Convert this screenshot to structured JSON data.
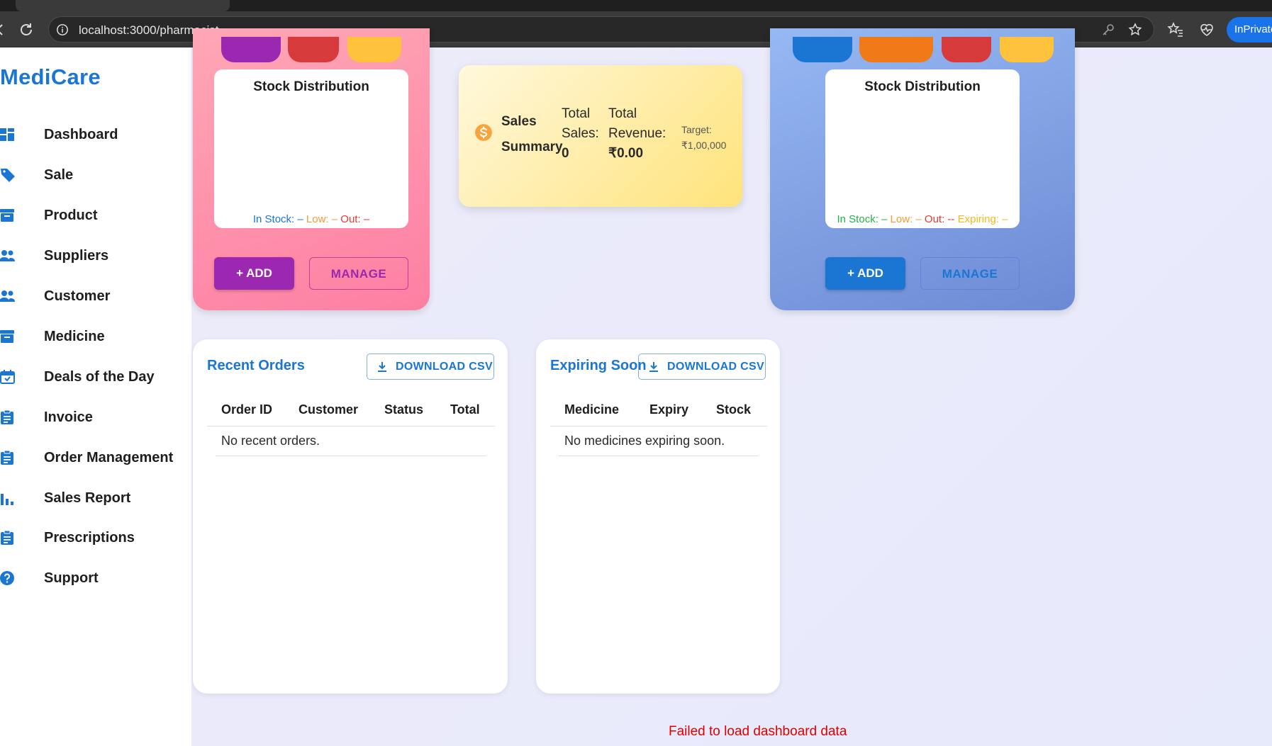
{
  "browser": {
    "url": "localhost:3000/pharmacist",
    "profile_label": "InPrivate"
  },
  "sidebar": {
    "brand": "MediCare",
    "items": [
      {
        "label": "Dashboard",
        "icon": "dashboard-icon"
      },
      {
        "label": "Sale",
        "icon": "tag-icon"
      },
      {
        "label": "Product",
        "icon": "archive-icon"
      },
      {
        "label": "Suppliers",
        "icon": "people-icon"
      },
      {
        "label": "Customer",
        "icon": "people-icon"
      },
      {
        "label": "Medicine",
        "icon": "archive-icon"
      },
      {
        "label": "Deals of the Day",
        "icon": "calendar-icon"
      },
      {
        "label": "Invoice",
        "icon": "clipboard-icon"
      },
      {
        "label": "Order Management",
        "icon": "clipboard-icon"
      },
      {
        "label": "Sales Report",
        "icon": "bar-chart-icon"
      },
      {
        "label": "Prescriptions",
        "icon": "clipboard-icon"
      },
      {
        "label": "Support",
        "icon": "help-icon"
      }
    ]
  },
  "product_card": {
    "stock_title": "Stock Distribution",
    "legend_in": "In Stock: –",
    "legend_low": "Low: –",
    "legend_out": "Out: –",
    "add_label": "+ ADD",
    "manage_label": "MANAGE"
  },
  "medicine_card": {
    "stock_title": "Stock Distribution",
    "legend_in": "In Stock: –",
    "legend_low": "Low: –",
    "legend_out": "Out: --",
    "legend_expiring": "Expiring: –",
    "add_label": "+ ADD",
    "manage_label": "MANAGE"
  },
  "sales_summary": {
    "title_line1": "Sales",
    "title_line2": "Summary",
    "sales_label_1": "Total",
    "sales_label_2": "Sales:",
    "sales_value": "0",
    "revenue_label_1": "Total",
    "revenue_label_2": "Revenue:",
    "revenue_value": "₹0.00",
    "target_label": "Target:",
    "target_value": "₹1,00,000"
  },
  "recent_orders": {
    "title": "Recent Orders",
    "csv_label": "DOWNLOAD CSV",
    "columns": [
      "Order ID",
      "Customer",
      "Status",
      "Total"
    ],
    "empty_text": "No recent orders."
  },
  "expiring_soon": {
    "title": "Expiring Soon",
    "csv_label": "DOWNLOAD CSV",
    "columns": [
      "Medicine",
      "Expiry",
      "Stock"
    ],
    "empty_text": "No medicines expiring soon."
  },
  "error_message": "Failed to load dashboard data",
  "colors": {
    "brand_blue": "#1a76d2",
    "purple": "#9c27b0",
    "error_red": "#e00000"
  }
}
